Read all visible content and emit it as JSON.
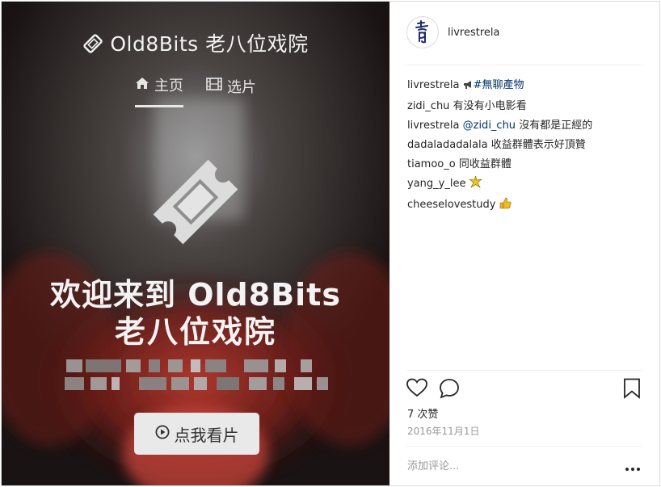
{
  "media": {
    "brand_title": "Old8Bits 老八位戏院",
    "nav": [
      {
        "label": "主页",
        "icon": "home-icon",
        "active": true
      },
      {
        "label": "选片",
        "icon": "film-icon",
        "active": false
      }
    ],
    "hero_line1": "欢迎来到 Old8Bits",
    "hero_line2": "老八位戏院",
    "cta_label": "点我看片",
    "cta_icon": "play-circle-icon"
  },
  "post": {
    "username": "livrestrela",
    "avatar_icon": "avatar-logo-icon",
    "comments": [
      {
        "user": "livrestrela",
        "emoji_icon": "bullhorn-icon",
        "hashtag": "#無聊產物",
        "text": ""
      },
      {
        "user": "zidi_chu",
        "text": "有没有小电影看"
      },
      {
        "user": "livrestrela",
        "mention": "@zidi_chu",
        "text": "沒有都是正經的"
      },
      {
        "user": "dadaladadalala",
        "text": "收益群體表示好頂贊"
      },
      {
        "user": "tiamoo_o",
        "text": "同收益群體"
      },
      {
        "user": "yang_y_lee",
        "emoji_icon": "sparkle-icon",
        "text": ""
      },
      {
        "user": "cheeselovestudy",
        "emoji_icon": "thumbs-up-icon",
        "text": ""
      }
    ],
    "likes": "7 次赞",
    "date": "2016年11月1日",
    "add_comment_placeholder": "添加评论...",
    "colors": {
      "link": "#003569",
      "muted": "#999999",
      "border": "#efefef"
    }
  }
}
